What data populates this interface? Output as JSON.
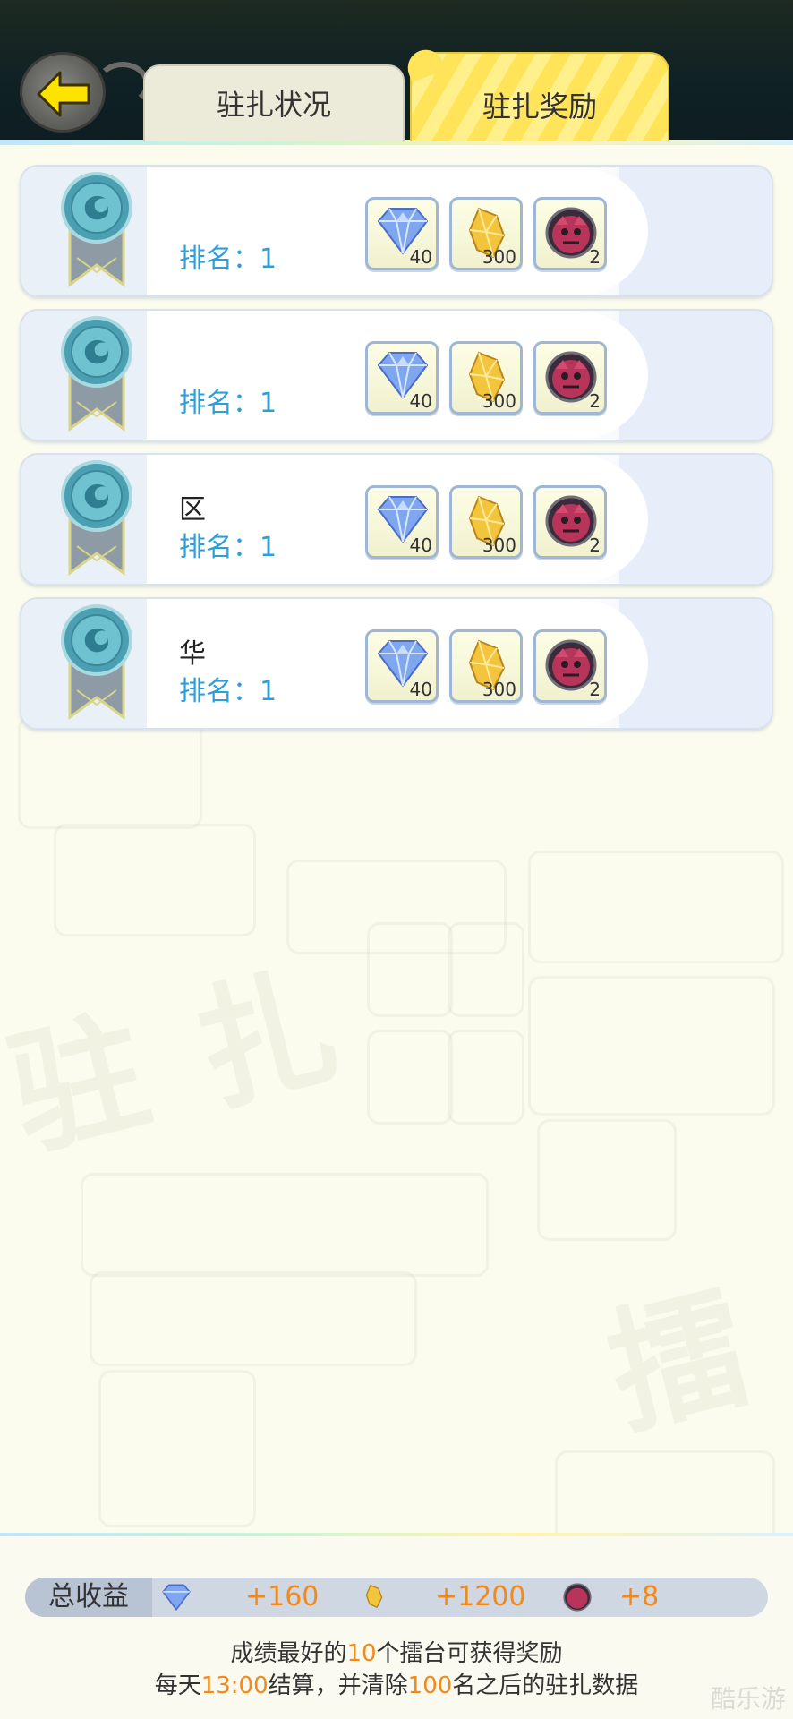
{
  "tabs": {
    "status": "驻扎状况",
    "rewards": "驻扎奖励"
  },
  "rows": [
    {
      "server": "",
      "rank_label": "排名：1",
      "items": [
        {
          "icon": "diamond-icon",
          "count": "40"
        },
        {
          "icon": "gold-crystal-icon",
          "count": "300"
        },
        {
          "icon": "red-spirit-icon",
          "count": "2"
        }
      ]
    },
    {
      "server": "",
      "rank_label": "排名：1",
      "items": [
        {
          "icon": "diamond-icon",
          "count": "40"
        },
        {
          "icon": "gold-crystal-icon",
          "count": "300"
        },
        {
          "icon": "red-spirit-icon",
          "count": "2"
        }
      ]
    },
    {
      "server": "区",
      "rank_label": "排名：1",
      "items": [
        {
          "icon": "diamond-icon",
          "count": "40"
        },
        {
          "icon": "gold-crystal-icon",
          "count": "300"
        },
        {
          "icon": "red-spirit-icon",
          "count": "2"
        }
      ]
    },
    {
      "server": "华",
      "rank_label": "排名：1",
      "items": [
        {
          "icon": "diamond-icon",
          "count": "40"
        },
        {
          "icon": "gold-crystal-icon",
          "count": "300"
        },
        {
          "icon": "red-spirit-icon",
          "count": "2"
        }
      ]
    }
  ],
  "totals": {
    "label": "总收益",
    "diamond": "+160",
    "gold": "+1200",
    "spirit": "+8"
  },
  "notes": {
    "line1_a": "成绩最好的",
    "line1_num": "10",
    "line1_b": "个擂台可获得奖励",
    "line2_a": "每天",
    "line2_time": "13:00",
    "line2_b": "结算，并清除",
    "line2_num": "100",
    "line2_c": "名之后的驻扎数据"
  },
  "watermark": "酷乐游",
  "colors": {
    "accent_orange": "#f28a1b",
    "rank_blue": "#2d9ed8",
    "tab_yellow": "#ffe45a"
  }
}
